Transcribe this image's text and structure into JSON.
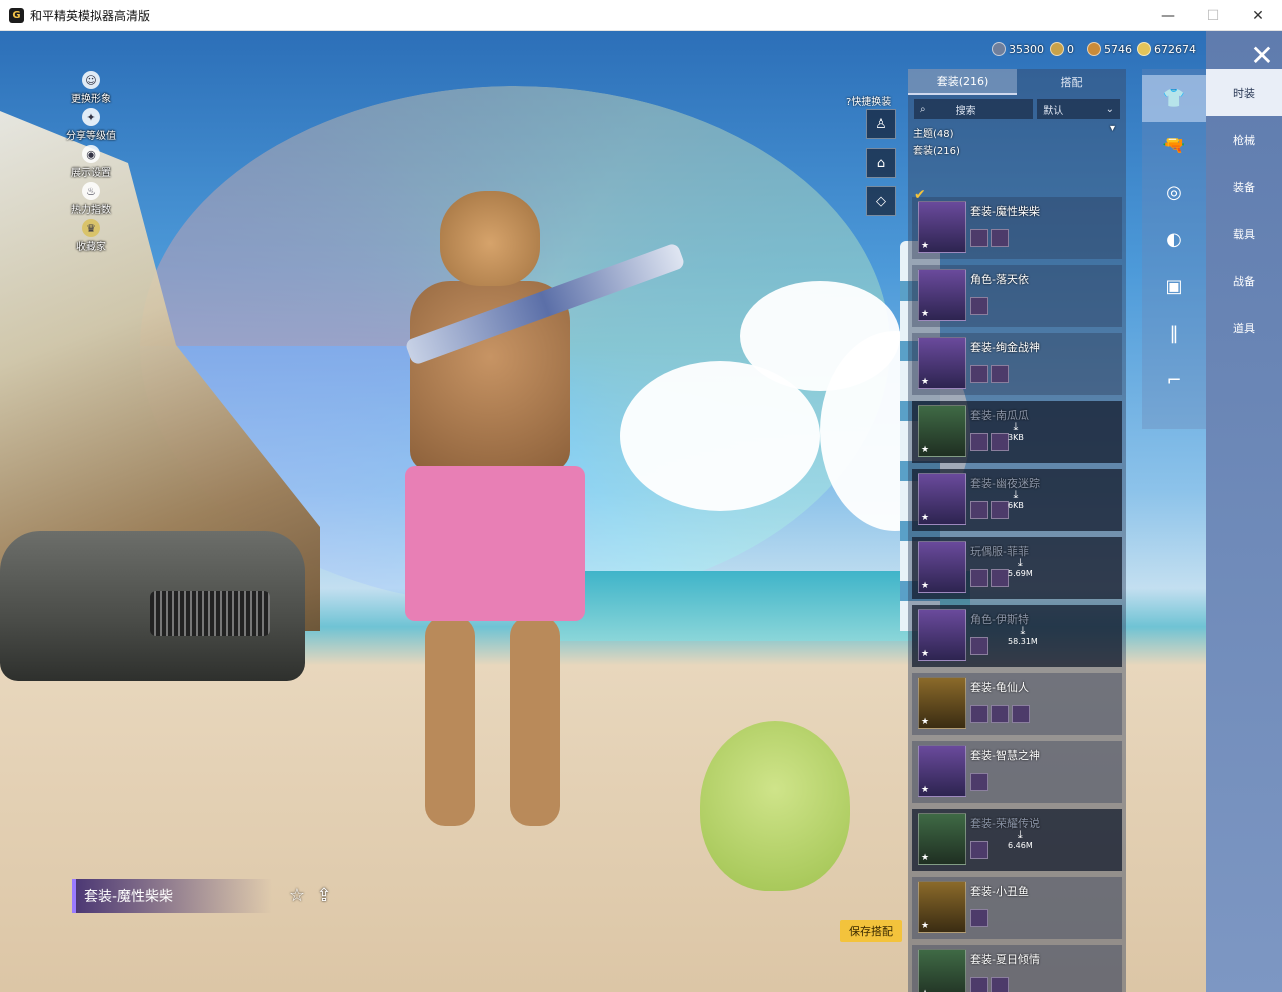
{
  "window": {
    "title": "和平精英模拟器高清版",
    "app_icon": "G",
    "minimize": "—",
    "maximize": "☐",
    "close": "✕"
  },
  "left_menu": [
    {
      "label": "更换形象",
      "icon": "user-icon"
    },
    {
      "label": "分享等级值",
      "icon": "share-icon"
    },
    {
      "label": "展示设置",
      "icon": "eye-icon"
    },
    {
      "label": "热力指数",
      "icon": "flame-icon"
    },
    {
      "label": "收藏家",
      "icon": "trophy-icon"
    }
  ],
  "currencies": [
    {
      "value": "35300",
      "color": "#6f7f9c"
    },
    {
      "value": "0",
      "color": "#c8a24a"
    },
    {
      "value": "5746",
      "color": "#c98b3a"
    },
    {
      "value": "672674",
      "color": "#e3c45a"
    }
  ],
  "quick_swap": {
    "label": "快捷换装",
    "help_icon": "?"
  },
  "outfit_plate": {
    "name": "套装-魔性柴柴"
  },
  "save_button": "保存搭配",
  "panel": {
    "tabs": [
      {
        "label": "套装(216)",
        "active": true
      },
      {
        "label": "搭配",
        "active": false
      }
    ],
    "search_placeholder": "搜索",
    "sort_label": "默认",
    "sections": {
      "theme": "主题(48)",
      "suit": "套装(216)"
    }
  },
  "outfits": [
    {
      "name": "套装-魔性柴柴",
      "locked": false,
      "parts": 2,
      "selected": true
    },
    {
      "name": "角色-落天依",
      "locked": false,
      "parts": 1
    },
    {
      "name": "套装-绚金战神",
      "locked": false,
      "parts": 2
    },
    {
      "name": "套装-南瓜瓜",
      "locked": true,
      "parts": 2,
      "size": "3KB"
    },
    {
      "name": "套装-幽夜迷踪",
      "locked": true,
      "parts": 2,
      "size": "6KB"
    },
    {
      "name": "玩偶服-菲菲",
      "locked": true,
      "parts": 2,
      "size": "5.69M"
    },
    {
      "name": "角色-伊斯特",
      "locked": true,
      "parts": 1,
      "size": "58.31M"
    },
    {
      "name": "套装-龟仙人",
      "locked": false,
      "parts": 3
    },
    {
      "name": "套装-智慧之神",
      "locked": false,
      "parts": 1
    },
    {
      "name": "套装-荣耀传说",
      "locked": true,
      "parts": 1,
      "size": "6.46M"
    },
    {
      "name": "套装-小丑鱼",
      "locked": false,
      "parts": 1
    },
    {
      "name": "套装-夏日倾情",
      "locked": false,
      "parts": 2
    }
  ],
  "rail_icons": [
    "outfit-icon",
    "weapon-icon",
    "goggles-icon",
    "mask-icon",
    "shirt-icon",
    "pants-icon",
    "shoes-icon"
  ],
  "side_categories": [
    {
      "label": "时装",
      "active": true
    },
    {
      "label": "枪械",
      "active": false
    },
    {
      "label": "装备",
      "active": false
    },
    {
      "label": "载具",
      "active": false
    },
    {
      "label": "战备",
      "active": false
    },
    {
      "label": "道具",
      "active": false
    }
  ]
}
